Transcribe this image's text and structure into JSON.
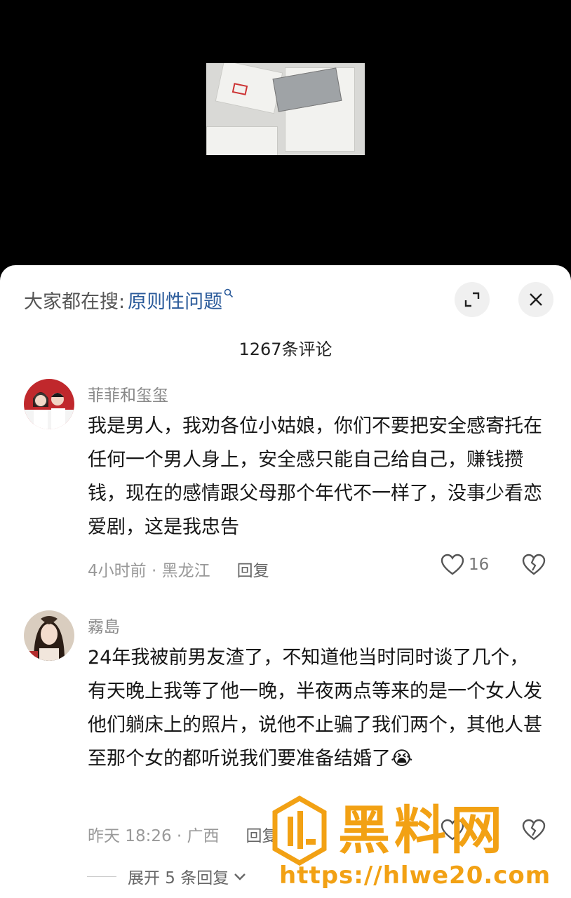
{
  "search": {
    "prefix": "大家都在搜:",
    "query": "原则性问题"
  },
  "comment_count": "1267条评论",
  "comments": [
    {
      "username": "菲菲和玺玺",
      "text": "我是男人，我劝各位小姑娘，你们不要把安全感寄托在任何一个男人身上，安全感只能自己给自己，赚钱攒钱，现在的感情跟父母那个年代不一样了，没事少看恋爱剧，这是我忠告",
      "time_location": "4小时前 · 黑龙江",
      "reply_label": "回复",
      "likes": "16"
    },
    {
      "username": "霧島",
      "text": "24年我被前男友渣了，不知道他当时同时谈了几个，有天晚上我等了他一晚，半夜两点等来的是一个女人发他们躺床上的照片，说他不止骗了我们两个，其他人甚至那个女的都听说我们要准备结婚了😭",
      "time_location": "昨天 18:26 · 广西",
      "reply_label": "回复"
    }
  ],
  "expand_replies": "展开 5 条回复",
  "watermark": {
    "title": "黑料网",
    "url": "https://hlwe20.com"
  },
  "colors": {
    "accent_link": "#2a5a9a",
    "watermark": "#f2a114"
  }
}
